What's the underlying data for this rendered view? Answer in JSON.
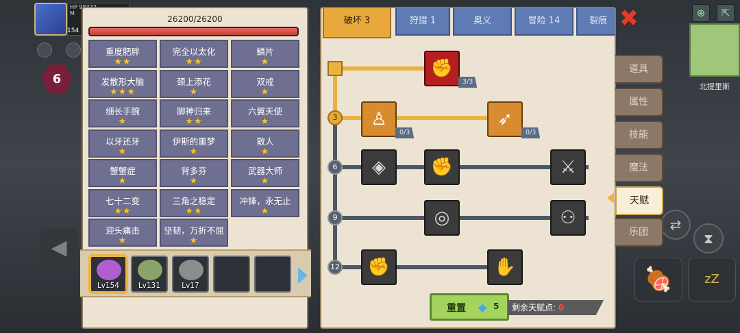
{
  "hero": {
    "hp_label": "HP",
    "hp_value": "98372",
    "mp_label": "M",
    "level": "154"
  },
  "hex_skill": {
    "value": "6"
  },
  "minimap": {
    "location": "北提里斯"
  },
  "left_panel": {
    "hp_text": "26200/26200",
    "hp_fraction": 1.0,
    "titles": [
      {
        "name": "重度肥胖",
        "stars": "★★"
      },
      {
        "name": "完全以太化",
        "stars": "★★"
      },
      {
        "name": "鳞片",
        "stars": "★"
      },
      {
        "name": "发散形大脑",
        "stars": "★★★"
      },
      {
        "name": "颈上添花",
        "stars": "★"
      },
      {
        "name": "双戒",
        "stars": "★"
      },
      {
        "name": "细长手腕",
        "stars": "★"
      },
      {
        "name": "脚神归来",
        "stars": "★★"
      },
      {
        "name": "六翼天使",
        "stars": "★"
      },
      {
        "name": "以牙还牙",
        "stars": "★"
      },
      {
        "name": "伊斯的噩梦",
        "stars": "★"
      },
      {
        "name": "散人",
        "stars": "★"
      },
      {
        "name": "蟹蟹症",
        "stars": "★"
      },
      {
        "name": "背多芬",
        "stars": "★"
      },
      {
        "name": "武器大师",
        "stars": "★"
      },
      {
        "name": "七十二变",
        "stars": "★★"
      },
      {
        "name": "三角之稳定",
        "stars": "★★"
      },
      {
        "name": "冲锋，永无止",
        "stars": "★"
      },
      {
        "name": "迎头痛击",
        "stars": "★"
      },
      {
        "name": "坚韧，万折不屈",
        "stars": "★"
      }
    ],
    "characters": [
      {
        "level": "Lv154",
        "color": "#b15fd0"
      },
      {
        "level": "Lv131",
        "color": "#8aa36b"
      },
      {
        "level": "Lv17",
        "color": "#8c8c8c"
      },
      {
        "level": "",
        "color": ""
      },
      {
        "level": "",
        "color": ""
      }
    ]
  },
  "tabs": [
    {
      "label": "破坏 3"
    },
    {
      "label": "狩猎 1"
    },
    {
      "label": "奥义"
    },
    {
      "label": "冒险 14"
    },
    {
      "label": "裂痕"
    }
  ],
  "tree": {
    "tiers": [
      "3",
      "6",
      "9",
      "12"
    ],
    "nodes": [
      {
        "icon": "arm-wrestle-icon",
        "glyph": "✊",
        "count": "3/3"
      },
      {
        "icon": "muscle-body-icon",
        "glyph": "♙",
        "count": "0/3"
      },
      {
        "icon": "arrow-burst-icon",
        "glyph": "➶",
        "count": "0/3"
      },
      {
        "icon": "shield-slash-icon",
        "glyph": "◈"
      },
      {
        "icon": "punch-icon",
        "glyph": "✊"
      },
      {
        "icon": "sword-splash-icon",
        "glyph": "⚔"
      },
      {
        "icon": "ripple-icon",
        "glyph": "◎"
      },
      {
        "icon": "bat-icon",
        "glyph": "⚇"
      },
      {
        "icon": "fist-icon",
        "glyph": "✊"
      },
      {
        "icon": "bandaged-hand-icon",
        "glyph": "✋"
      }
    ]
  },
  "reset": {
    "label": "重置",
    "cost": "5"
  },
  "talent_points": {
    "label": "剩余天赋点:",
    "value": "0"
  },
  "side_menu": [
    {
      "label": "道具"
    },
    {
      "label": "属性"
    },
    {
      "label": "技能"
    },
    {
      "label": "魔法"
    },
    {
      "label": "天赋"
    },
    {
      "label": "乐团"
    }
  ],
  "colors": {
    "panel": "#ece3d2",
    "tab_active": "#e8a83c",
    "tab_inactive": "#5f7bb3",
    "title_cell": "#6f6f92",
    "star": "#f5c531",
    "hp_bar": "#c24236",
    "reset_button": "#a4d45e",
    "points_value": "#ff4b3b"
  }
}
